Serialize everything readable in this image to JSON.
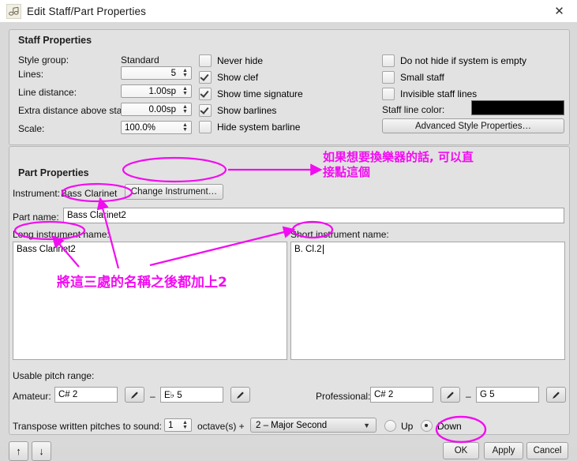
{
  "window": {
    "title": "Edit Staff/Part Properties",
    "icon": "musescore-logo-icon",
    "close_label": "✕"
  },
  "staff_properties": {
    "group_title": "Staff Properties",
    "style_group_label": "Style group:",
    "style_group_value": "Standard",
    "lines_label": "Lines:",
    "lines_value": "5",
    "line_distance_label": "Line distance:",
    "line_distance_value": "1.00sp",
    "extra_distance_label": "Extra distance above staff:",
    "extra_distance_value": "0.00sp",
    "scale_label": "Scale:",
    "scale_value": "100.0%",
    "checkboxes_left": [
      {
        "label": "Never hide",
        "checked": false
      },
      {
        "label": "Show clef",
        "checked": true
      },
      {
        "label": "Show time signature",
        "checked": true
      },
      {
        "label": "Show barlines",
        "checked": true
      },
      {
        "label": "Hide system barline",
        "checked": false
      }
    ],
    "checkboxes_right": [
      {
        "label": "Do not hide if system is empty",
        "checked": false
      },
      {
        "label": "Small staff",
        "checked": false
      },
      {
        "label": "Invisible staff lines",
        "checked": false
      }
    ],
    "staff_line_color_label": "Staff line color:",
    "staff_line_color_value": "#000000",
    "advanced_button": "Advanced Style Properties…"
  },
  "part_properties": {
    "group_title": "Part Properties",
    "instrument_label": "Instrument:",
    "instrument_value": "Bass Clarinet",
    "change_instrument_button": "Change Instrument…",
    "part_name_label": "Part name:",
    "part_name_value": "Bass Clarinet2",
    "long_name_label": "Long instrument name:",
    "long_name_value": "Bass Clarinet2",
    "short_name_label": "Short instrument name:",
    "short_name_value": "B. Cl.2",
    "usable_pitch_range_label": "Usable pitch range:",
    "amateur_label": "Amateur:",
    "amateur_low": "C# 2",
    "amateur_high": "E♭ 5",
    "professional_label": "Professional:",
    "professional_low": "C# 2",
    "professional_high": "G 5",
    "range_dash": "–",
    "pencil_icon": "pencil-icon",
    "transpose_label": "Transpose written pitches to sound:",
    "transpose_octaves": "1",
    "transpose_octave_suffix": "octave(s) +",
    "transpose_interval": "2 – Major Second",
    "direction_up_label": "Up",
    "direction_down_label": "Down",
    "direction_selected": "Down"
  },
  "footer": {
    "move_up_label": "↑",
    "move_down_label": "↓",
    "ok_label": "OK",
    "apply_label": "Apply",
    "cancel_label": "Cancel"
  },
  "annotations": {
    "color": "#f20cf2",
    "note_change_instrument": "如果想要換樂器的話, 可以直\n接點這個",
    "note_add_two": "將這三處的名稱之後都加上2"
  }
}
